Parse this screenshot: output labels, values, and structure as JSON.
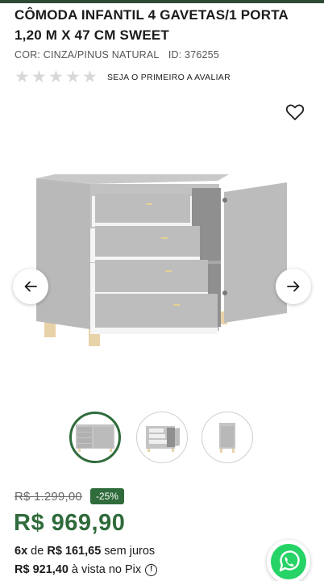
{
  "product": {
    "title": "CÔMODA INFANTIL 4 GAVETAS/1 PORTA 1,20 M X 47 CM SWEET",
    "color": "COR: CINZA/PINUS NATURAL",
    "id": "ID: 376255",
    "rating": 0,
    "rating_max": 5,
    "review_cta": "SEJA O PRIMEIRO A AVALIAR"
  },
  "gallery": {
    "icons": {
      "wishlist": "heart-icon",
      "prev": "arrow-left-icon",
      "next": "arrow-right-icon"
    },
    "thumbnail_count": 3,
    "active_thumbnail": 1
  },
  "pricing": {
    "old_price": "R$ 1.299,00",
    "discount": "-25%",
    "price": "R$ 969,90",
    "installments_count": "6x",
    "installments_of": "de",
    "installment_value": "R$ 161,65",
    "installments_suffix": "sem juros",
    "pix_price": "R$ 921,40",
    "pix_suffix": "à vista no Pix"
  },
  "colors": {
    "brand_green": "#2f6b3b",
    "top_bar": "#2e4a32",
    "whatsapp": "#25d366"
  }
}
